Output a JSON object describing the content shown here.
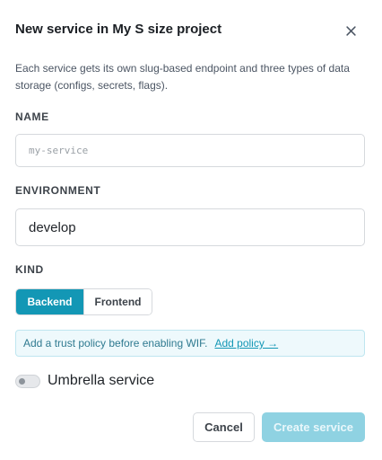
{
  "dialog": {
    "title": "New service in My S size project",
    "description": "Each service gets its own slug-based endpoint and three types of data storage (configs, secrets, flags)."
  },
  "fields": {
    "name": {
      "label": "NAME",
      "placeholder": "my-service",
      "value": ""
    },
    "environment": {
      "label": "ENVIRONMENT",
      "value": "develop"
    },
    "kind": {
      "label": "KIND",
      "options": [
        "Backend",
        "Frontend"
      ],
      "selected": "Backend"
    }
  },
  "notice": {
    "text": "Add a trust policy before enabling WIF.",
    "link": "Add policy →"
  },
  "umbrella": {
    "label": "Umbrella service",
    "enabled": false
  },
  "actions": {
    "cancel": "Cancel",
    "create": "Create service",
    "create_disabled": true
  },
  "colors": {
    "accent": "#1397b5",
    "accent_disabled": "#8fd2e2",
    "notice_bg": "#eef9fc"
  },
  "icons": {
    "close": "close-icon"
  }
}
